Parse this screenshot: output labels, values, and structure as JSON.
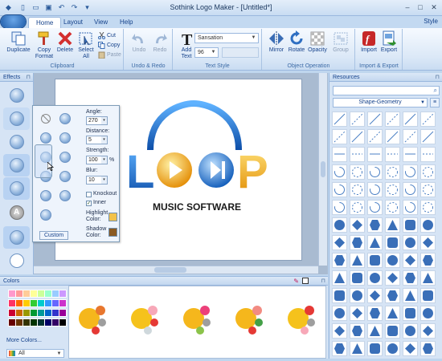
{
  "window": {
    "title": "Sothink Logo Maker - [Untitled*]"
  },
  "tabs": [
    "Home",
    "Layout",
    "View",
    "Help"
  ],
  "style_label": "Style",
  "ribbon": {
    "clipboard": {
      "label": "Clipboard",
      "duplicate": "Duplicate",
      "copy_format": "Copy\nFormat",
      "delete": "Delete",
      "select_all": "Select\nAll",
      "cut": "Cut",
      "copy": "Copy",
      "paste": "Paste"
    },
    "undo_redo": {
      "label": "Undo & Redo",
      "undo": "Undo",
      "redo": "Redo"
    },
    "text_style": {
      "label": "Text Style",
      "add_text": "Add\nText",
      "font": "Sansation",
      "size": "96"
    },
    "object_operation": {
      "label": "Object Operation",
      "mirror": "Mirror",
      "rotate": "Rotate",
      "opacity": "Opacity",
      "group": "Group"
    },
    "import_export": {
      "label": "Import & Export",
      "import": "Import",
      "export": "Export"
    }
  },
  "effects": {
    "title": "Effects",
    "panel": {
      "angle_label": "Angle:",
      "angle": "270",
      "distance_label": "Distance:",
      "distance": "5",
      "strength_label": "Strength:",
      "strength": "100",
      "percent": "%",
      "blur_label": "Blur:",
      "blur": "10",
      "knockout": "Knockout",
      "inner": "Inner",
      "inner_checked": true,
      "highlight_label": "Highlight\nColor:",
      "highlight_color": "#f3c24a",
      "shadow_label": "Shadow\nColor:",
      "shadow_color": "#8a5a22",
      "custom": "Custom"
    }
  },
  "logo": {
    "tagline": "MUSIC SOFTWARE",
    "letters": [
      "L",
      "P"
    ]
  },
  "resources": {
    "title": "Resources",
    "category": "Shape-Geometry"
  },
  "colors": {
    "title": "Colors",
    "more": "More Colors...",
    "filter": "All",
    "palette": [
      "#ff99cc",
      "#ff9999",
      "#ffcc99",
      "#ffff99",
      "#ccff99",
      "#99ffcc",
      "#99ccff",
      "#cc99ff",
      "#ff3366",
      "#ff6600",
      "#ffcc00",
      "#33cc33",
      "#00cccc",
      "#3399ff",
      "#6666ff",
      "#cc33cc",
      "#cc0033",
      "#cc6600",
      "#999900",
      "#009933",
      "#009999",
      "#0066cc",
      "#3333cc",
      "#990099",
      "#660000",
      "#663300",
      "#333300",
      "#003300",
      "#003333",
      "#000066",
      "#330066",
      "#000000"
    ]
  },
  "colors_accent": "#f5a623"
}
